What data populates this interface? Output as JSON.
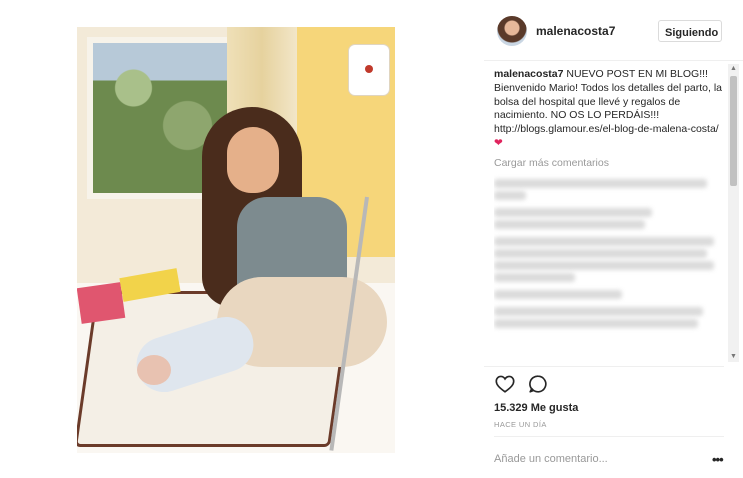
{
  "post": {
    "username": "malenacosta7",
    "follow_label": "Siguiendo",
    "caption_user": "malenacosta7",
    "caption_text": " NUEVO POST EN MI BLOG!!! Bienvenido Mario! Todos los detalles del parto, la bolsa del hospital que llevé y regalos de nacimiento. NO OS LO PERDÁIS!!! http://blogs.glamour.es/el-blog-de-malena-costa/",
    "caption_emoji": "❤",
    "load_more": "Cargar más comentarios",
    "likes": "15.329 Me gusta",
    "time": "HACE UN DÍA",
    "add_comment_placeholder": "Añade un comentario...",
    "more": "•••"
  },
  "icons": {
    "heart": "heart-icon",
    "comment": "comment-icon",
    "more": "more-options-icon"
  },
  "colors": {
    "text": "#262626",
    "muted": "#999999",
    "border": "#efefef"
  }
}
